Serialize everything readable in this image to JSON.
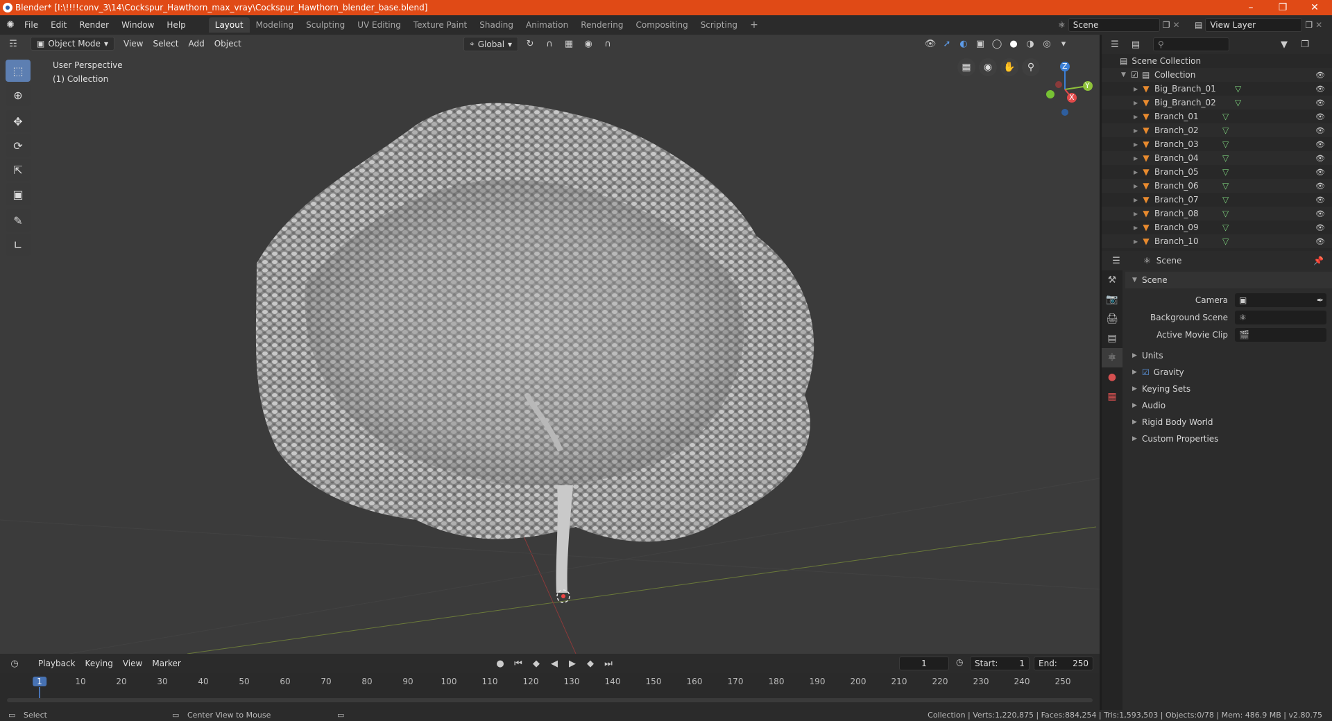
{
  "titlebar": {
    "title": "Blender* [I:\\!!!!conv_3\\14\\Cockspur_Hawthorn_max_vray\\Cockspur_Hawthorn_blender_base.blend]"
  },
  "menu": {
    "items": [
      "File",
      "Edit",
      "Render",
      "Window",
      "Help"
    ]
  },
  "workspaces": [
    "Layout",
    "Modeling",
    "Sculpting",
    "UV Editing",
    "Texture Paint",
    "Shading",
    "Animation",
    "Rendering",
    "Compositing",
    "Scripting"
  ],
  "scene_selector": {
    "value": "Scene"
  },
  "viewlayer_selector": {
    "value": "View Layer"
  },
  "viewport": {
    "mode": "Object Mode",
    "header_menus": [
      "View",
      "Select",
      "Add",
      "Object"
    ],
    "transform_orientation": "Global",
    "overlay_line1": "User Perspective",
    "overlay_line2": "(1) Collection",
    "gizmo": {
      "z": "Z",
      "x": "X",
      "y": "Y"
    }
  },
  "outliner": {
    "scene_collection": "Scene Collection",
    "collection": "Collection",
    "items": [
      "Big_Branch_01",
      "Big_Branch_02",
      "Branch_01",
      "Branch_02",
      "Branch_03",
      "Branch_04",
      "Branch_05",
      "Branch_06",
      "Branch_07",
      "Branch_08",
      "Branch_09",
      "Branch_10"
    ]
  },
  "properties": {
    "context": "Scene",
    "panel_title": "Scene",
    "fields": {
      "camera": "Camera",
      "background_scene": "Background Scene",
      "active_movie_clip": "Active Movie Clip"
    },
    "sections": {
      "units": "Units",
      "gravity": "Gravity",
      "keying_sets": "Keying Sets",
      "audio": "Audio",
      "rigid_body_world": "Rigid Body World",
      "custom_properties": "Custom Properties"
    },
    "gravity_checked": true
  },
  "timeline": {
    "menus": [
      "Playback",
      "Keying",
      "View",
      "Marker"
    ],
    "current_frame": "1",
    "start_label": "Start:",
    "start": "1",
    "end_label": "End:",
    "end": "250",
    "ticks": [
      "1",
      "10",
      "20",
      "30",
      "40",
      "50",
      "60",
      "70",
      "80",
      "90",
      "100",
      "110",
      "120",
      "130",
      "140",
      "150",
      "160",
      "170",
      "180",
      "190",
      "200",
      "210",
      "220",
      "230",
      "240",
      "250"
    ]
  },
  "status": {
    "left": "Select",
    "middle": "Center View to Mouse",
    "right": "Collection | Verts:1,220,875 | Faces:884,254 | Tris:1,593,503 | Objects:0/78 | Mem: 486.9 MB | v2.80.75"
  },
  "colors": {
    "titlebar": "#e04a16",
    "active_tool": "#5d7fb2",
    "frame_marker": "#4772b3"
  }
}
